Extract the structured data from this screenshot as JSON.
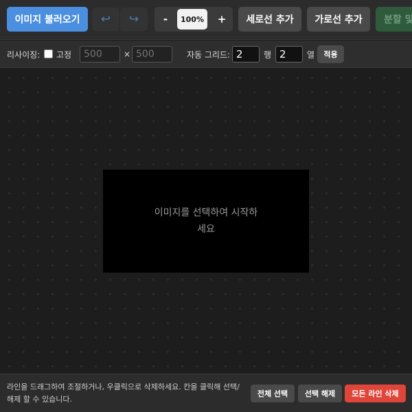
{
  "toolbar": {
    "load_label": "이미지 불러오기",
    "undo_icon": "↩",
    "redo_icon": "↪",
    "zoom_minus": "-",
    "zoom_value": "100%",
    "zoom_plus": "+",
    "add_vertical_label": "세로선 추가",
    "add_horizontal_label": "가로선 추가",
    "split_label": "분할 및",
    "accent_color": "#4a8fe0"
  },
  "options": {
    "resize_label": "리사이징:",
    "fixed_label": "고정",
    "width_placeholder": "500",
    "times_sign": "×",
    "height_placeholder": "500",
    "auto_grid_label": "자동 그리드:",
    "rows_value": "2",
    "rows_unit": "행",
    "cols_value": "2",
    "cols_unit": "열",
    "apply_label": "적용"
  },
  "canvas": {
    "placeholder_text": "이미지를 선택하여 시작하세요"
  },
  "status": {
    "hint_text": "라인을 드래그하여 조절하거나, 우클릭으로 삭제하세요. 칸을 클릭해 선택/해제 할 수 있습니다.",
    "select_all_label": "전체 선택",
    "deselect_label": "선택 해제",
    "delete_all_label": "모든 라인 삭제",
    "danger_color": "#e0453a"
  }
}
